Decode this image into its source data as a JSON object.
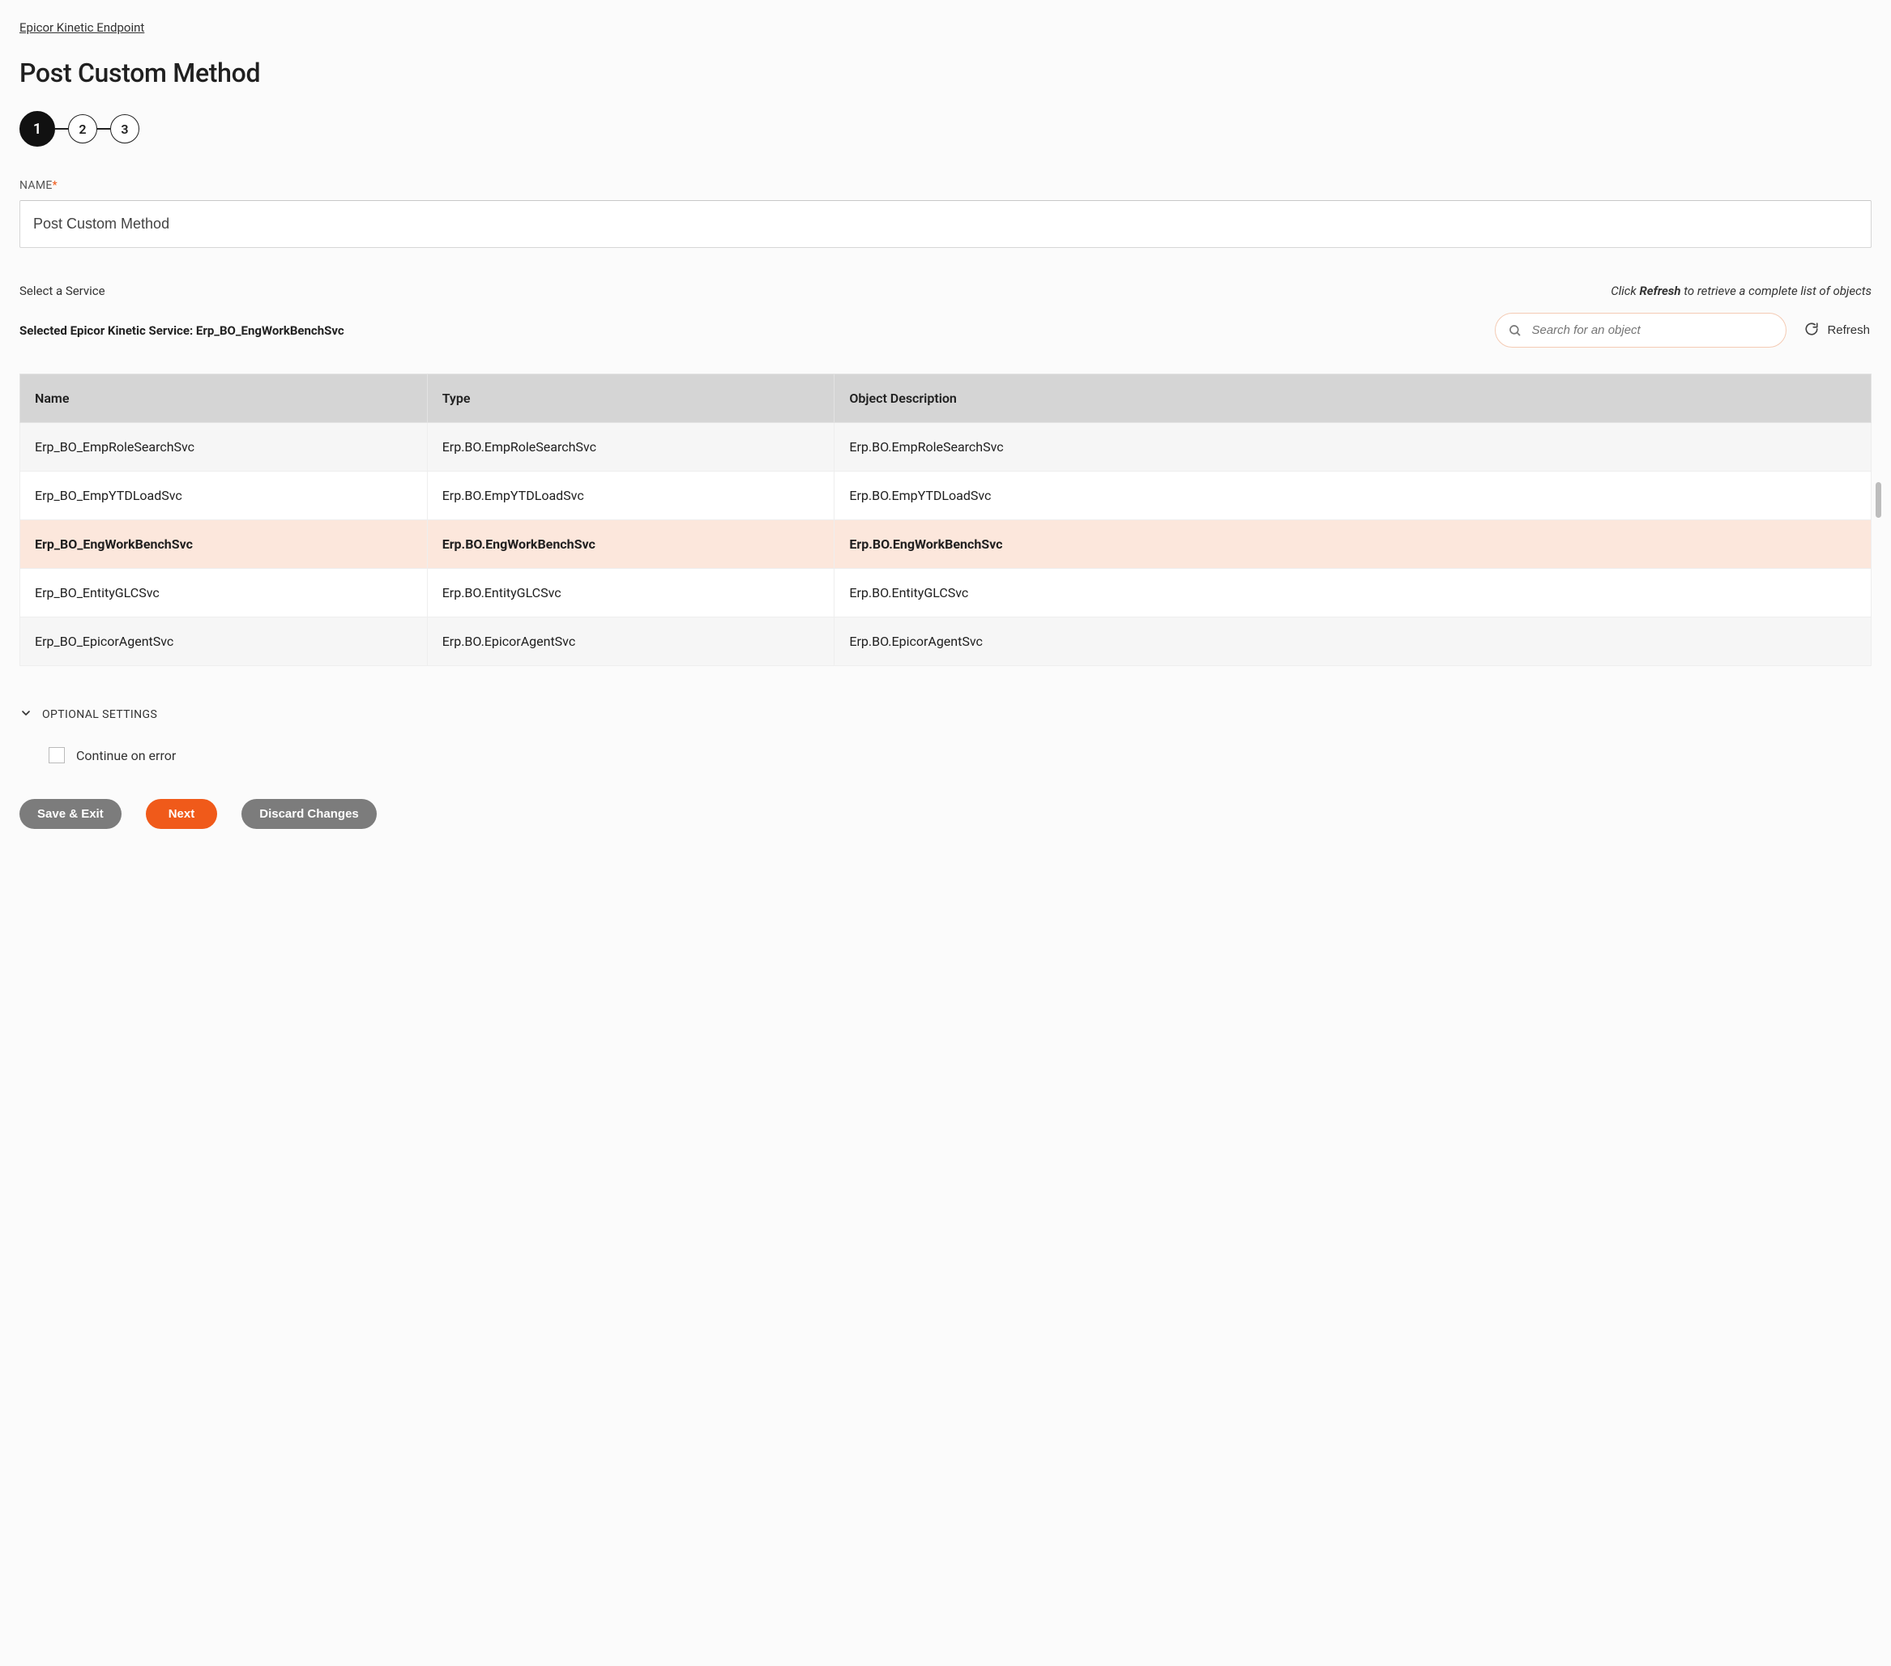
{
  "breadcrumb": "Epicor Kinetic Endpoint",
  "title": "Post Custom Method",
  "stepper": {
    "steps": [
      "1",
      "2",
      "3"
    ],
    "active_index": 0
  },
  "name_field": {
    "label": "NAME",
    "required_mark": "*",
    "value": "Post Custom Method"
  },
  "service": {
    "select_label": "Select a Service",
    "refresh_hint_prefix": "Click ",
    "refresh_hint_bold": "Refresh",
    "refresh_hint_suffix": " to retrieve a complete list of objects",
    "selected_prefix": "Selected Epicor Kinetic Service: ",
    "selected_value": "Erp_BO_EngWorkBenchSvc",
    "search_placeholder": "Search for an object",
    "refresh_button": "Refresh"
  },
  "table": {
    "columns": [
      "Name",
      "Type",
      "Object Description"
    ],
    "rows": [
      {
        "name": "Erp_BO_EmpRoleSearchSvc",
        "type": "Erp.BO.EmpRoleSearchSvc",
        "desc": "Erp.BO.EmpRoleSearchSvc",
        "alt": true,
        "selected": false
      },
      {
        "name": "Erp_BO_EmpYTDLoadSvc",
        "type": "Erp.BO.EmpYTDLoadSvc",
        "desc": "Erp.BO.EmpYTDLoadSvc",
        "alt": false,
        "selected": false
      },
      {
        "name": "Erp_BO_EngWorkBenchSvc",
        "type": "Erp.BO.EngWorkBenchSvc",
        "desc": "Erp.BO.EngWorkBenchSvc",
        "alt": false,
        "selected": true
      },
      {
        "name": "Erp_BO_EntityGLCSvc",
        "type": "Erp.BO.EntityGLCSvc",
        "desc": "Erp.BO.EntityGLCSvc",
        "alt": false,
        "selected": false
      },
      {
        "name": "Erp_BO_EpicorAgentSvc",
        "type": "Erp.BO.EpicorAgentSvc",
        "desc": "Erp.BO.EpicorAgentSvc",
        "alt": true,
        "selected": false
      }
    ]
  },
  "optional": {
    "header": "OPTIONAL SETTINGS",
    "continue_on_error": "Continue on error"
  },
  "buttons": {
    "save_exit": "Save & Exit",
    "next": "Next",
    "discard": "Discard Changes"
  }
}
